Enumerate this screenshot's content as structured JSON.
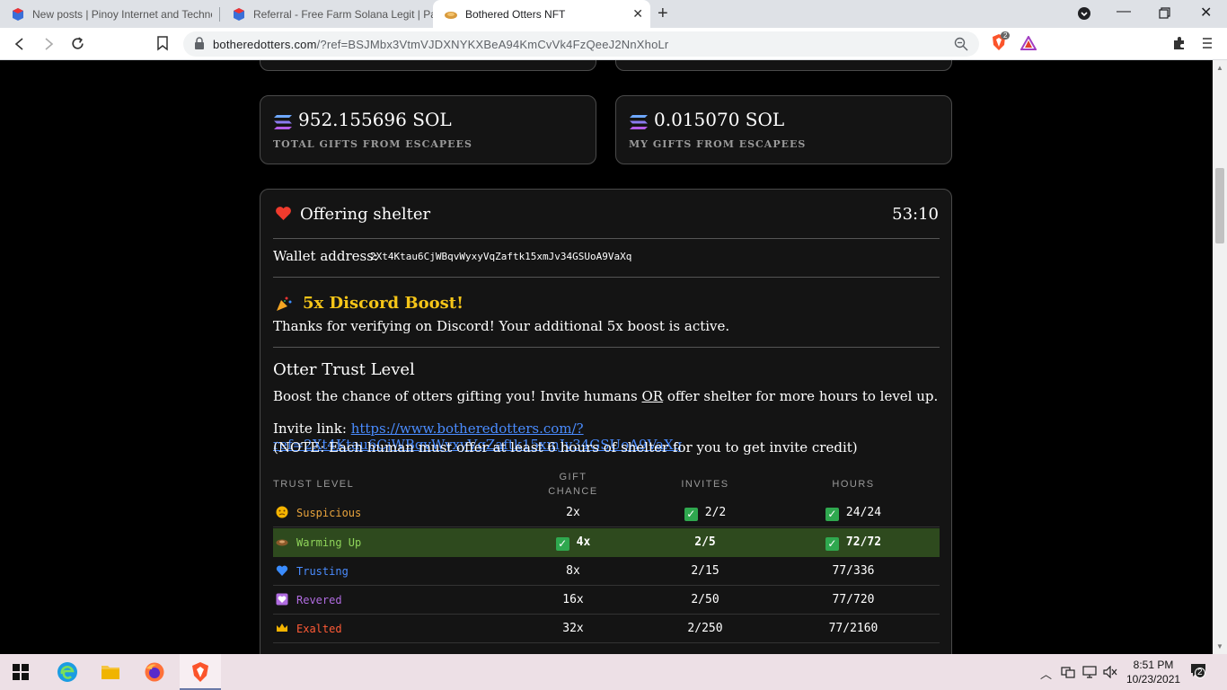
{
  "browser": {
    "tabs": [
      {
        "title": "New posts | Pinoy Internet and Techno"
      },
      {
        "title": "Referral - Free Farm Solana Legit | Pag"
      },
      {
        "title": "Bothered Otters NFT"
      }
    ],
    "url_domain": "botheredotters.com",
    "url_path": "/?ref=BSJMbx3VtmVJDXNYKXBeA94KmCvVk4FzQeeJ2NnXhoLr",
    "shield_badge": "2"
  },
  "stats": [
    {
      "value": "952.155696 SOL",
      "label": "TOTAL GIFTS FROM ESCAPEES"
    },
    {
      "value": "0.015070 SOL",
      "label": "MY GIFTS FROM ESCAPEES"
    }
  ],
  "shelter": {
    "title": "Offering shelter",
    "timer": "53:10",
    "wallet_label": "Wallet address:",
    "wallet_address": "2Xt4Ktau6CjWBqvWyxyVqZaftk15xmJv34GSUoA9VaXq"
  },
  "boost": {
    "title": "5x Discord Boost!",
    "text": "Thanks for verifying on Discord! Your additional 5x boost is active."
  },
  "trust": {
    "title": "Otter Trust Level",
    "desc_before": "Boost the chance of otters gifting you! Invite humans ",
    "desc_or": "OR",
    "desc_after": " offer shelter for more hours to level up.",
    "invite_label": "Invite link: ",
    "invite_link": "https://www.botheredotters.com/?ref=2Xt4Ktau6CjWBqvWyxyVqZaftk15xmJv34GSUoA9VaXq",
    "note": "(NOTE: Each human must offer at least 6 hours of shelter for you to get invite credit)",
    "headers": {
      "level": "TRUST LEVEL",
      "gift1": "GIFT",
      "gift2": "CHANCE",
      "invites": "INVITES",
      "hours": "HOURS"
    },
    "rows": [
      {
        "level": "Suspicious",
        "color": "#e8a33c",
        "chance": "2x",
        "invites": "2/2",
        "hours": "24/24"
      },
      {
        "level": "Warming Up",
        "color": "#8fd45a",
        "chance": "4x",
        "invites": "2/5",
        "hours": "72/72"
      },
      {
        "level": "Trusting",
        "color": "#4a8cff",
        "chance": "8x",
        "invites": "2/15",
        "hours": "77/336"
      },
      {
        "level": "Revered",
        "color": "#b06ce0",
        "chance": "16x",
        "invites": "2/50",
        "hours": "77/720"
      },
      {
        "level": "Exalted",
        "color": "#ff5a36",
        "chance": "32x",
        "invites": "2/250",
        "hours": "77/2160"
      }
    ]
  },
  "taskbar": {
    "time": "8:51 PM",
    "date": "10/23/2021",
    "notifications": "2"
  }
}
